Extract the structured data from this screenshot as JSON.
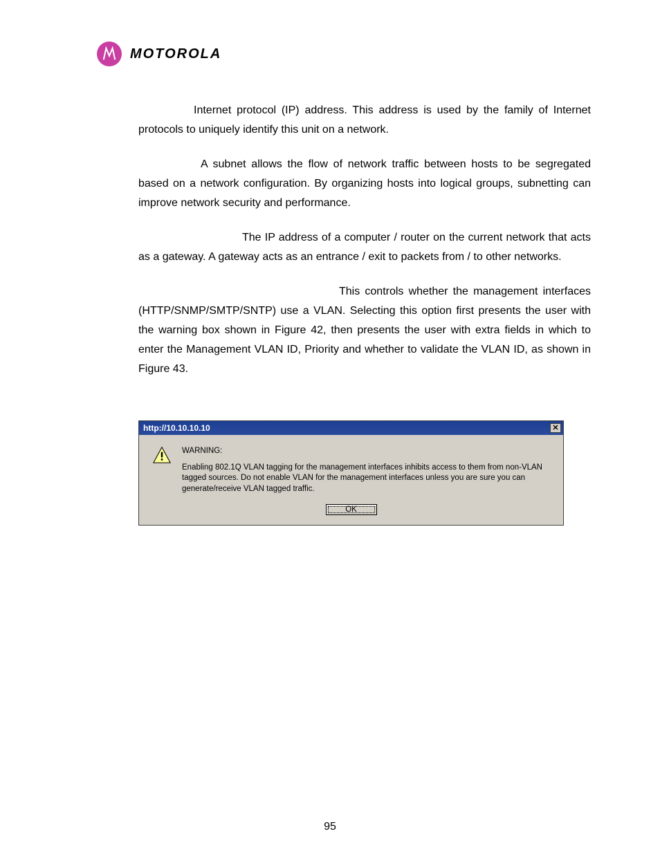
{
  "brand": "MOTOROLA",
  "paragraphs": {
    "p1": "Internet protocol (IP) address. This address is used by the family of Internet protocols to uniquely identify this unit on a network.",
    "p2": "A subnet allows the flow of network traffic between hosts to be segregated based on a network configuration. By organizing hosts into logical groups, subnetting can improve network security and performance.",
    "p3": "The IP address of a computer / router on the current network that acts as a gateway. A gateway acts as an entrance / exit to packets from / to other networks.",
    "p4": "This controls whether the management interfaces (HTTP/SNMP/SMTP/SNTP) use a VLAN. Selecting this option first presents the user with the warning box shown in Figure 42, then presents the user with extra fields in which to enter the Management VLAN ID, Priority and whether to validate the VLAN ID, as shown in Figure 43."
  },
  "dialog": {
    "title": "http://10.10.10.10",
    "close": "✕",
    "warn_title": "WARNING:",
    "warn_body": "Enabling 802.1Q VLAN tagging for the management interfaces inhibits access to them from non-VLAN tagged sources. Do not enable VLAN for the management interfaces unless you are sure you can generate/receive VLAN tagged traffic.",
    "ok": "OK"
  },
  "page_number": "95"
}
